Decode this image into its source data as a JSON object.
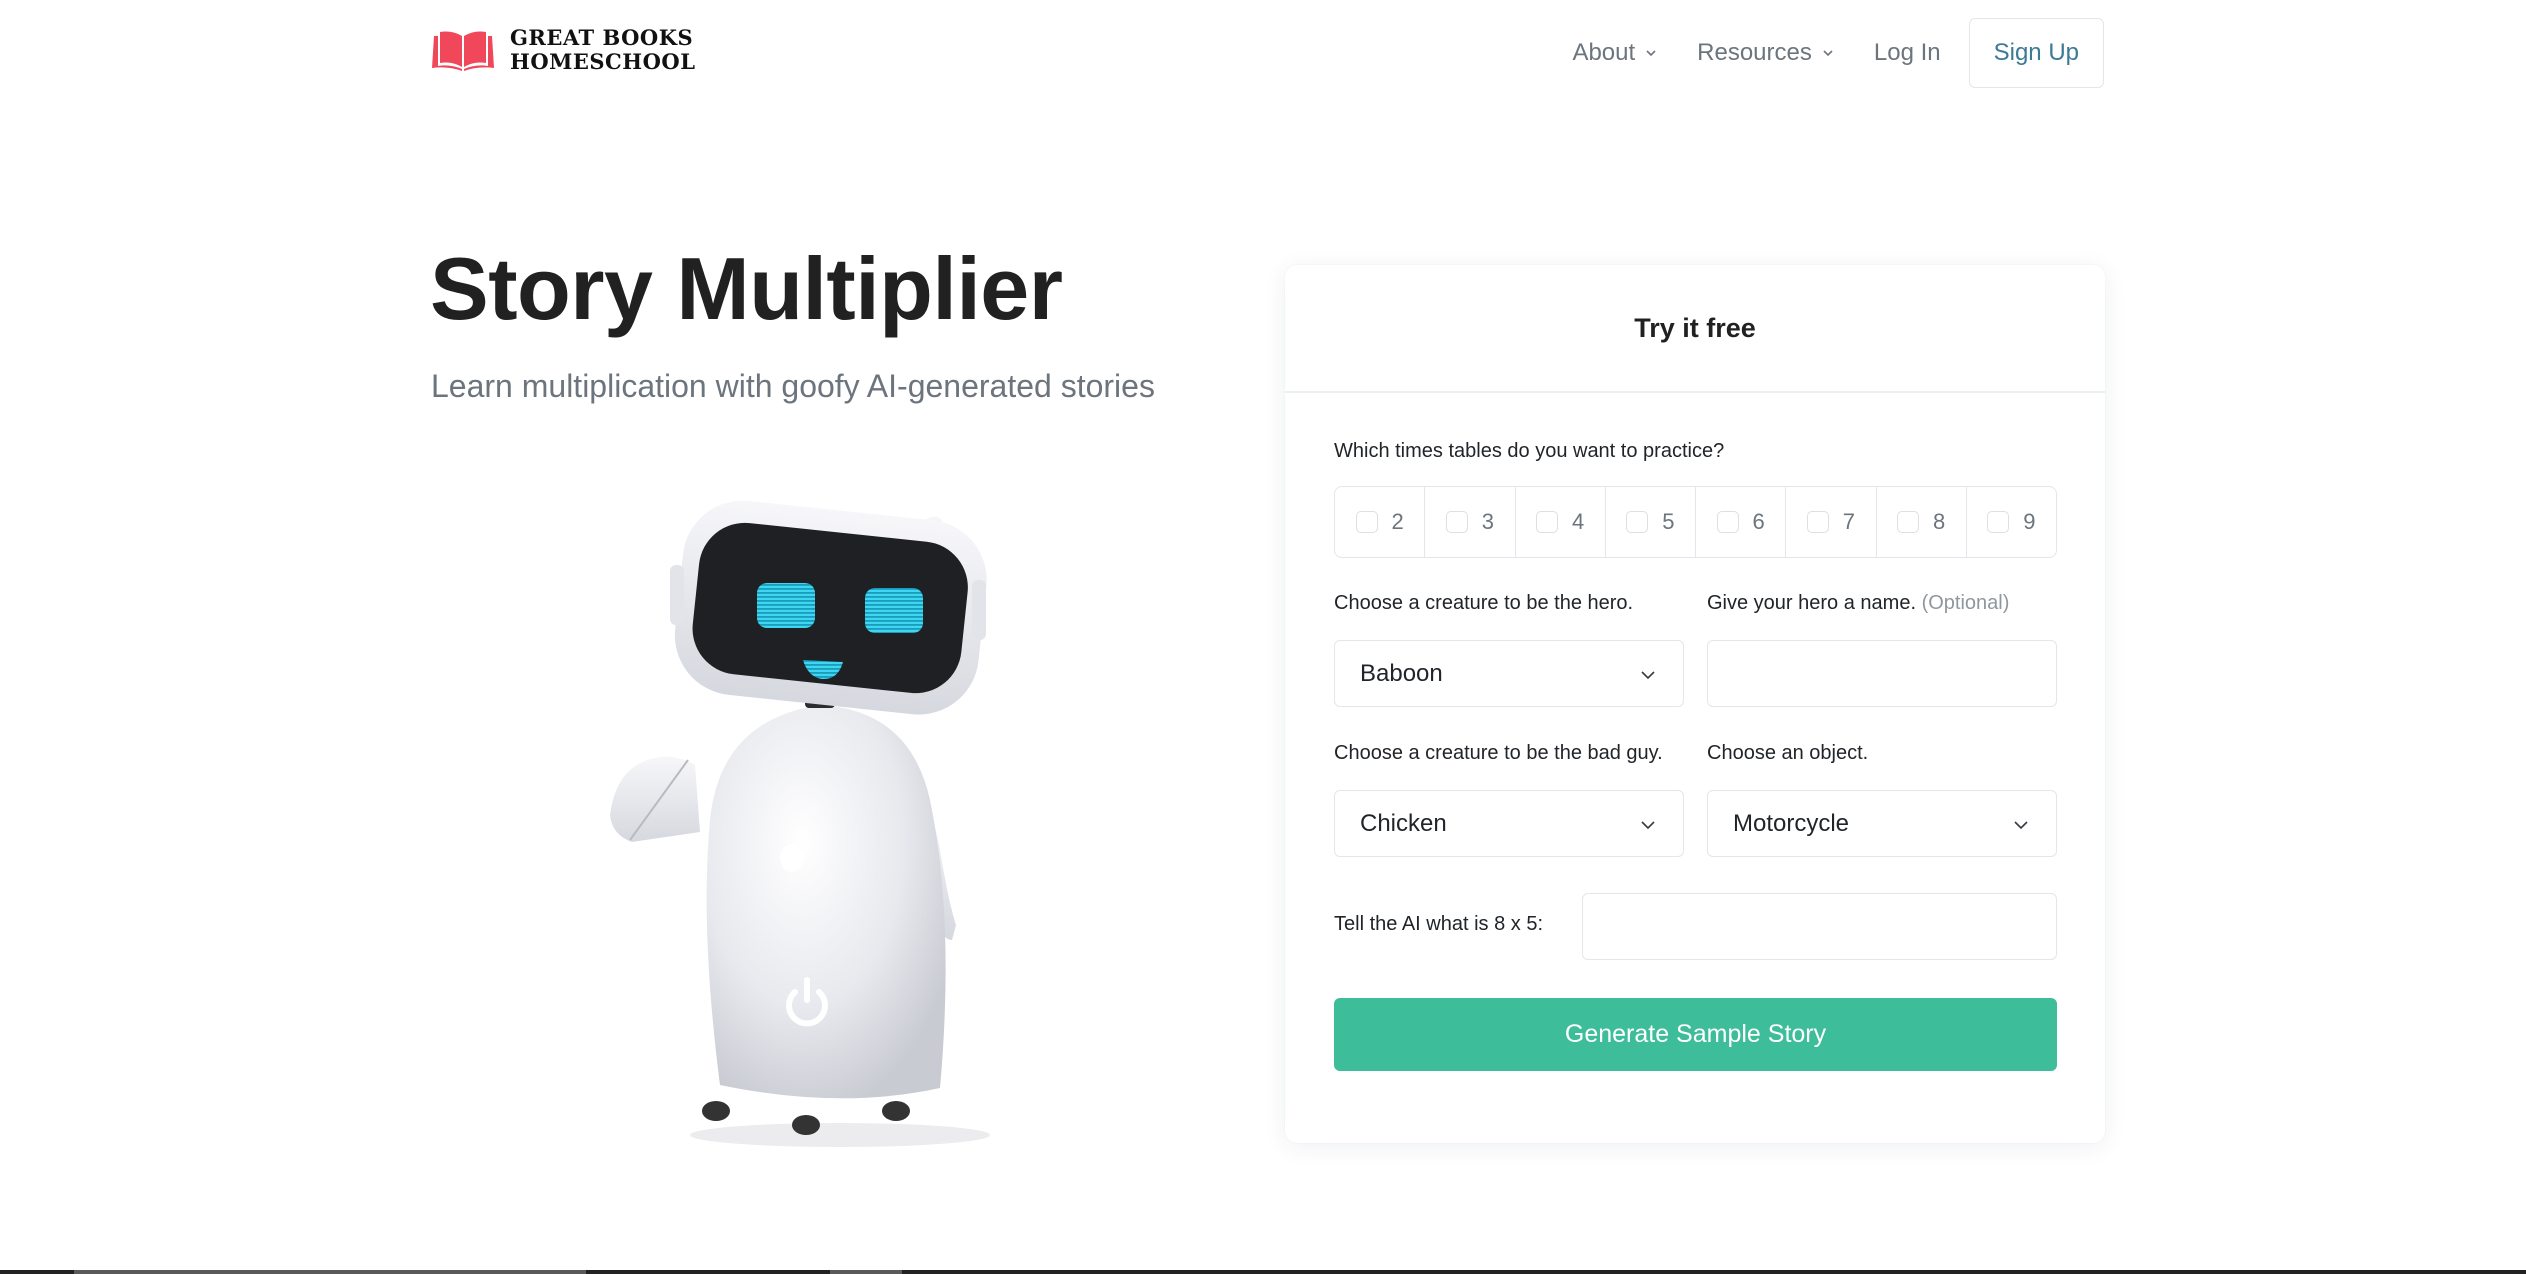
{
  "header": {
    "logo": {
      "line1": "GREAT BOOKS",
      "line2": "HOMESCHOOL",
      "icon": "open-book-icon",
      "color": "#f0485a"
    },
    "nav": [
      {
        "label": "About",
        "has_dropdown": true
      },
      {
        "label": "Resources",
        "has_dropdown": true
      },
      {
        "label": "Log In",
        "has_dropdown": false
      }
    ],
    "signup_label": "Sign Up"
  },
  "hero": {
    "title": "Story Multiplier",
    "subtitle": "Learn multiplication with goofy AI-generated stories",
    "image": "waving-robot-illustration"
  },
  "form": {
    "title": "Try it free",
    "times_tables": {
      "label": "Which times tables do you want to practice?",
      "options": [
        {
          "value": "2",
          "checked": false
        },
        {
          "value": "3",
          "checked": false
        },
        {
          "value": "4",
          "checked": false
        },
        {
          "value": "5",
          "checked": false
        },
        {
          "value": "6",
          "checked": false
        },
        {
          "value": "7",
          "checked": false
        },
        {
          "value": "8",
          "checked": false
        },
        {
          "value": "9",
          "checked": false
        }
      ]
    },
    "hero_creature": {
      "label": "Choose a creature to be the hero.",
      "value": "Baboon"
    },
    "hero_name": {
      "label": "Give your hero a name.",
      "optional_label": "(Optional)",
      "value": "",
      "placeholder": ""
    },
    "bad_guy": {
      "label": "Choose a creature to be the bad guy.",
      "value": "Chicken"
    },
    "object": {
      "label": "Choose an object.",
      "value": "Motorcycle"
    },
    "captcha": {
      "label": "Tell the AI what is 8 x 5:",
      "value": "",
      "placeholder": ""
    },
    "submit_label": "Generate Sample Story",
    "accent_color": "#3dbd99"
  }
}
